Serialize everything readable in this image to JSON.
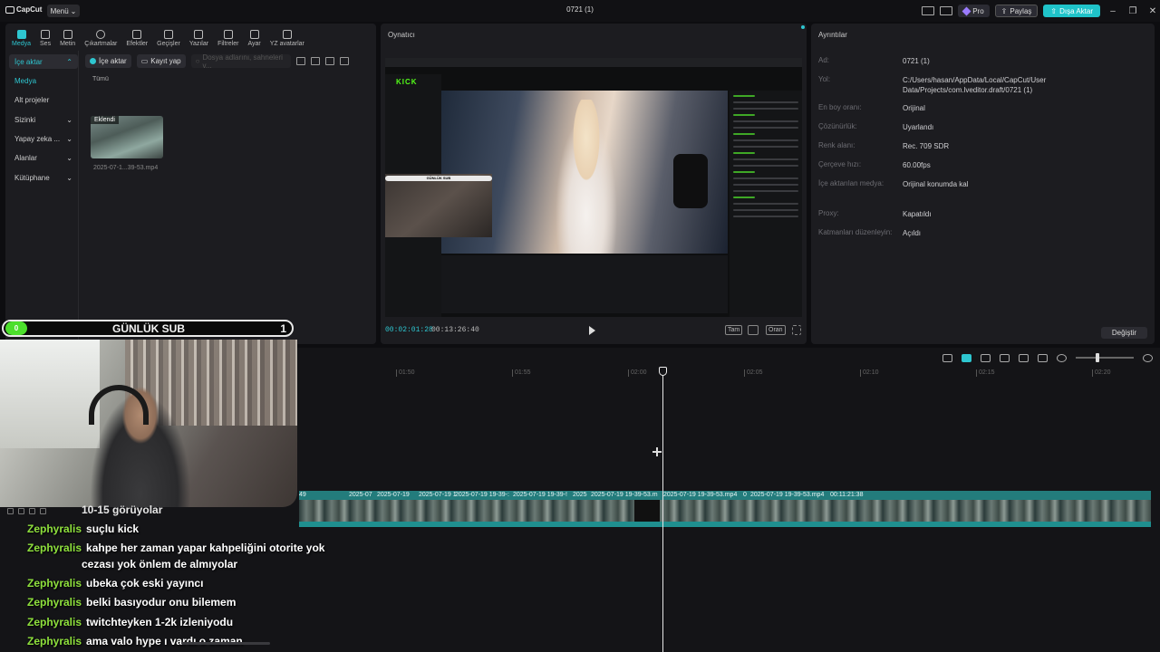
{
  "app": {
    "logo": "CapCut",
    "menu_label": "Menü",
    "window_title": "0721 (1)"
  },
  "titlebar": {
    "pro_label": "Pro",
    "share_label": "Paylaş",
    "export_label": "Dışa Aktar"
  },
  "media": {
    "tools": [
      {
        "label": "Medya",
        "icon": "media-icon"
      },
      {
        "label": "Ses",
        "icon": "audio-icon"
      },
      {
        "label": "Metin",
        "icon": "text-icon"
      },
      {
        "label": "Çıkartmalar",
        "icon": "sticker-icon"
      },
      {
        "label": "Efektler",
        "icon": "effects-icon"
      },
      {
        "label": "Geçişler",
        "icon": "transitions-icon"
      },
      {
        "label": "Yazılar",
        "icon": "captions-icon"
      },
      {
        "label": "Filtreler",
        "icon": "filters-icon"
      },
      {
        "label": "Ayar",
        "icon": "adjust-icon"
      },
      {
        "label": "YZ avatarlar",
        "icon": "ai-avatar-icon"
      }
    ],
    "sidebar": [
      {
        "label": "İçe aktar",
        "chev": "⌃"
      },
      {
        "label": "Medya",
        "chev": ""
      },
      {
        "label": "Alt projeler",
        "chev": ""
      },
      {
        "label": "Sizinki",
        "chev": "⌄"
      },
      {
        "label": "Yapay zeka ...",
        "chev": "⌄"
      },
      {
        "label": "Alanlar",
        "chev": "⌄"
      },
      {
        "label": "Kütüphane",
        "chev": "⌄"
      }
    ],
    "import_label": "İçe aktar",
    "record_label": "Kayıt yap",
    "search_placeholder": "Dosya adlarını, sahneleri v...",
    "all_label": "Tümü",
    "thumb_tag": "Eklendi",
    "thumb_name": "2025-07-1...39-53.mp4"
  },
  "player": {
    "title": "Oynatıcı",
    "time_current": "00:02:01:28",
    "time_total": "00:13:26:40",
    "full_label": "Tam",
    "ratio_label": "Oran",
    "preview": {
      "logo": "KICK",
      "overlay_bar": "GÜNLÜK SUB"
    }
  },
  "details": {
    "title": "Ayrıntılar",
    "rows": [
      {
        "key": "Ad:",
        "value": "0721 (1)"
      },
      {
        "key": "Yol:",
        "value": "C:/Users/hasan/AppData/Local/CapCut/User Data/Projects/com.lveditor.draft/0721 (1)"
      },
      {
        "key": "En boy oranı:",
        "value": "Orijinal"
      },
      {
        "key": "Çözünürlük:",
        "value": "Uyarlandı"
      },
      {
        "key": "Renk alanı:",
        "value": "Rec. 709 SDR"
      },
      {
        "key": "Çerçeve hızı:",
        "value": "60.00fps"
      },
      {
        "key": "İçe aktarılan medya:",
        "value": "Orijinal konumda kal"
      },
      {
        "key": "Proxy:",
        "value": "Kapatıldı"
      },
      {
        "key": "Katmanları düzenleyin:",
        "value": "Açıldı"
      }
    ],
    "change_label": "Değiştir"
  },
  "timeline": {
    "ticks": [
      "01:50",
      "01:55",
      "02:00",
      "02:05",
      "02:10",
      "02:15",
      "02:20"
    ],
    "clips": [
      "49",
      "2025-07",
      "2025-07-19",
      "2025-07-19 1",
      "2025-07-19 19-39-:",
      "2025-07-19 19-39-!",
      "2025",
      "2025-07-19 19-39-53.m",
      "2025-07-19 19-39-53.mp4",
      "0",
      "2025-07-19 19-39-53.mp4",
      "00:11:21:38"
    ]
  },
  "overlay": {
    "sub_left": "0",
    "sub_title": "GÜNLÜK SUB",
    "sub_count": "1",
    "top_partial": "10-15 görüyolar",
    "messages": [
      {
        "user": "Zephyralis",
        "text": "suçlu kick"
      },
      {
        "user": "Zephyralis",
        "text": "kahpe her zaman yapar kahpeliğini otorite yok"
      },
      {
        "user": "",
        "text": "cezası yok önlem de almıyolar"
      },
      {
        "user": "Zephyralis",
        "text": "ubeka çok eski yayıncı"
      },
      {
        "user": "Zephyralis",
        "text": "belki basıyodur onu bilemem"
      },
      {
        "user": "Zephyralis",
        "text": "twitchteyken 1-2k izleniyodu"
      },
      {
        "user": "Zephyralis",
        "text": "ama valo hype ı vardı o zaman"
      }
    ]
  },
  "colors": {
    "accent": "#2ec6d0",
    "chat_user": "#8ee03c",
    "track": "#237c7c"
  }
}
